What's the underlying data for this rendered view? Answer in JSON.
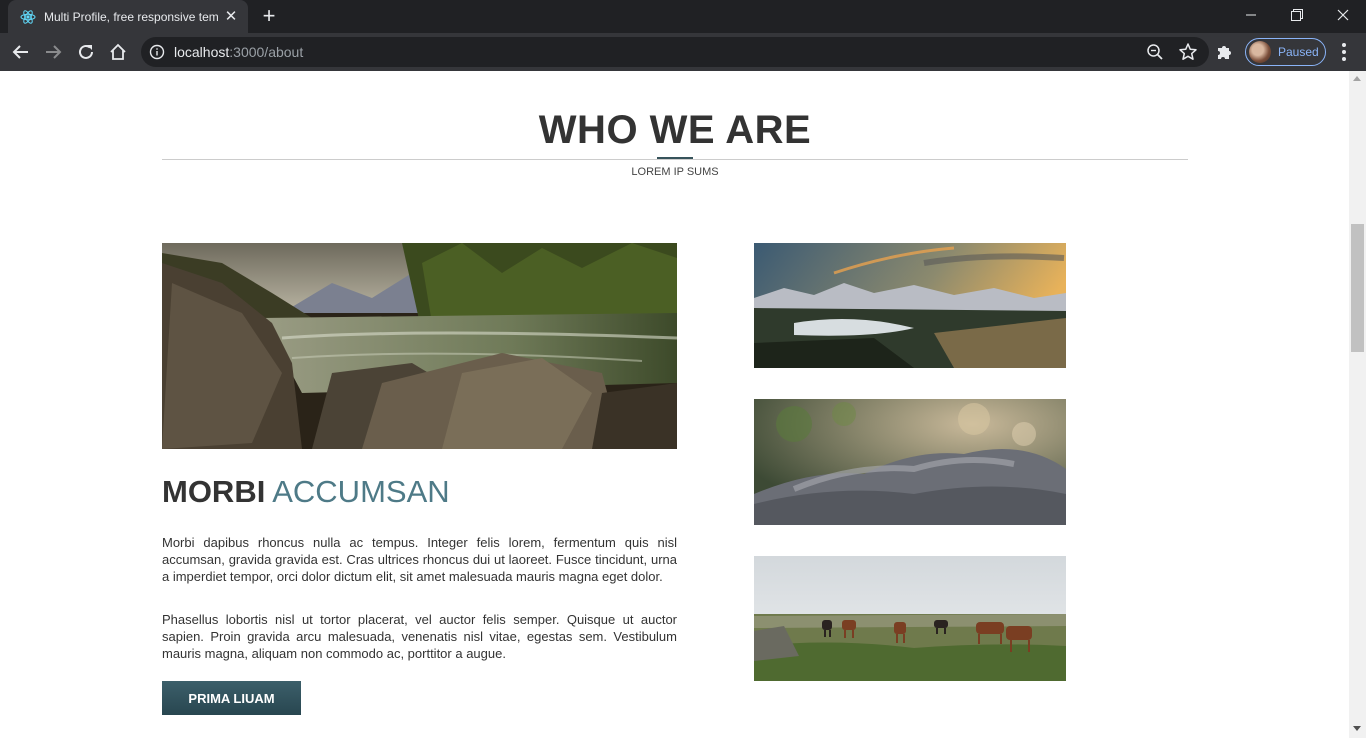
{
  "browser": {
    "tab_title": "Multi Profile, free responsive tem",
    "url_host": "localhost",
    "url_path": ":3000/about",
    "profile_label": "Paused"
  },
  "page": {
    "heading": "WHO WE ARE",
    "subheading": "LOREM IP SUMS",
    "section_title_bold": "MORBI",
    "section_title_light": "ACCUMSAN",
    "paragraphs": [
      "Morbi dapibus rhoncus nulla ac tempus. Integer felis lorem, fermentum quis nisl accumsan, gravida gravida est. Cras ultrices rhoncus dui ut laoreet. Fusce tincidunt, urna a imperdiet tempor, orci dolor dictum elit, sit amet malesuada mauris magna eget dolor.",
      "Phasellus lobortis nisl ut tortor placerat, vel auctor felis semper. Quisque ut auctor sapien. Proin gravida arcu malesuada, venenatis nisl vitae, egestas sem. Vestibulum mauris magna, aliquam non commodo ac, porttitor a augue."
    ],
    "button_label": "PRIMA LIUAM",
    "images": [
      {
        "icon": "river-rocks-image"
      },
      {
        "icon": "mountain-sunset-image"
      },
      {
        "icon": "mossy-rock-image"
      },
      {
        "icon": "horses-meadow-image"
      }
    ]
  },
  "colors": {
    "accent": "#37535b",
    "title_light": "#4e7a87",
    "button": "#2f4f59",
    "chrome_dark": "#202124",
    "chrome_tab": "#35363a",
    "profile_blue": "#8ab4f8"
  }
}
